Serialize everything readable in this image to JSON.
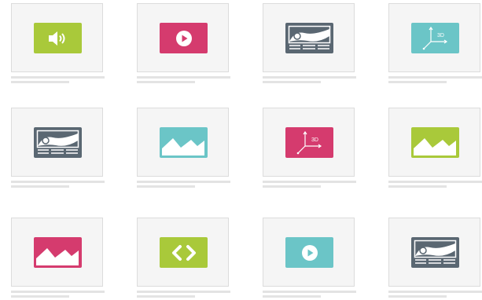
{
  "colors": {
    "lime": "#a9c93a",
    "magenta": "#d53b6e",
    "teal": "#6bc5c7",
    "slate": "#5a6772"
  },
  "tiles": [
    {
      "type": "audio",
      "icon": "speaker-icon",
      "color": "#a9c93a"
    },
    {
      "type": "video",
      "icon": "play-icon",
      "color": "#d53b6e"
    },
    {
      "type": "panorama",
      "icon": "panorama-icon",
      "color": "#5a6772"
    },
    {
      "type": "3d",
      "icon": "axes-3d-icon",
      "color": "#6bc5c7"
    },
    {
      "type": "panorama",
      "icon": "panorama-icon",
      "color": "#5a6772"
    },
    {
      "type": "image",
      "icon": "mountain-image-icon",
      "color": "#6bc5c7"
    },
    {
      "type": "3d",
      "icon": "axes-3d-icon",
      "color": "#d53b6e"
    },
    {
      "type": "image",
      "icon": "mountain-image-icon",
      "color": "#a9c93a"
    },
    {
      "type": "image",
      "icon": "mountain-image-icon",
      "color": "#d53b6e"
    },
    {
      "type": "embed",
      "icon": "code-brackets-icon",
      "color": "#a9c93a"
    },
    {
      "type": "video",
      "icon": "play-icon",
      "color": "#6bc5c7"
    },
    {
      "type": "panorama",
      "icon": "panorama-icon",
      "color": "#5a6772"
    }
  ],
  "axis_label_3d": "3D"
}
